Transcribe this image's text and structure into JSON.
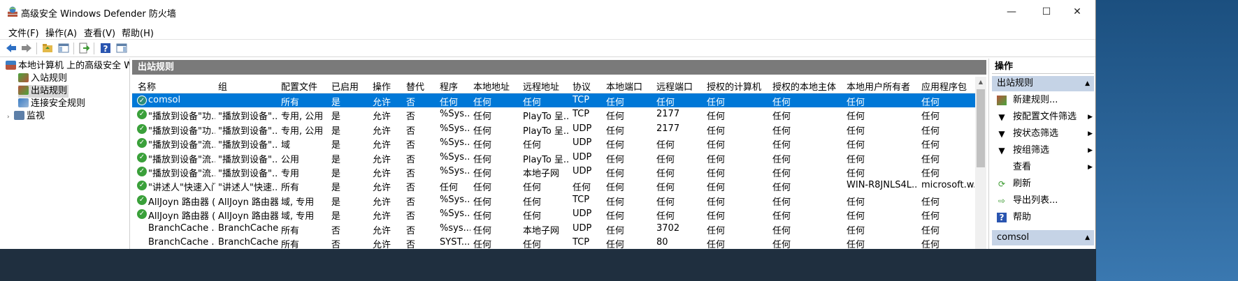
{
  "window": {
    "title": "高级安全 Windows Defender 防火墙",
    "minimize": "—",
    "maximize": "☐",
    "close": "✕"
  },
  "menu": [
    "文件(F)",
    "操作(A)",
    "查看(V)",
    "帮助(H)"
  ],
  "tree": {
    "root": "本地计算机 上的高级安全 Windows Defender 防火墙",
    "items": [
      "入站规则",
      "出站规则",
      "连接安全规则",
      "监视"
    ],
    "selected": "出站规则"
  },
  "panel": {
    "title": "出站规则",
    "columns": [
      "名称",
      "组",
      "配置文件",
      "已启用",
      "操作",
      "替代",
      "程序",
      "本地地址",
      "远程地址",
      "协议",
      "本地端口",
      "远程端口",
      "授权的计算机",
      "授权的本地主体",
      "本地用户所有者",
      "应用程序包"
    ],
    "rows": [
      {
        "icon": true,
        "cells": [
          "comsol",
          "",
          "所有",
          "是",
          "允许",
          "否",
          "任何",
          "任何",
          "任何",
          "TCP",
          "任何",
          "任何",
          "任何",
          "任何",
          "任何",
          "任何"
        ]
      },
      {
        "icon": true,
        "cells": [
          "\"播放到设备\"功...",
          "\"播放到设备\"...",
          "专用, 公用",
          "是",
          "允许",
          "否",
          "%Sys...",
          "任何",
          "PlayTo 呈...",
          "TCP",
          "任何",
          "2177",
          "任何",
          "任何",
          "任何",
          "任何"
        ]
      },
      {
        "icon": true,
        "cells": [
          "\"播放到设备\"功...",
          "\"播放到设备\"...",
          "专用, 公用",
          "是",
          "允许",
          "否",
          "%Sys...",
          "任何",
          "PlayTo 呈...",
          "UDP",
          "任何",
          "2177",
          "任何",
          "任何",
          "任何",
          "任何"
        ]
      },
      {
        "icon": true,
        "cells": [
          "\"播放到设备\"流...",
          "\"播放到设备\"...",
          "域",
          "是",
          "允许",
          "否",
          "%Sys...",
          "任何",
          "任何",
          "UDP",
          "任何",
          "任何",
          "任何",
          "任何",
          "任何",
          "任何"
        ]
      },
      {
        "icon": true,
        "cells": [
          "\"播放到设备\"流...",
          "\"播放到设备\"...",
          "公用",
          "是",
          "允许",
          "否",
          "%Sys...",
          "任何",
          "PlayTo 呈...",
          "UDP",
          "任何",
          "任何",
          "任何",
          "任何",
          "任何",
          "任何"
        ]
      },
      {
        "icon": true,
        "cells": [
          "\"播放到设备\"流...",
          "\"播放到设备\"...",
          "专用",
          "是",
          "允许",
          "否",
          "%Sys...",
          "任何",
          "本地子网",
          "UDP",
          "任何",
          "任何",
          "任何",
          "任何",
          "任何",
          "任何"
        ]
      },
      {
        "icon": true,
        "cells": [
          "\"讲述人\"快速入门",
          "\"讲述人\"快速...",
          "所有",
          "是",
          "允许",
          "否",
          "任何",
          "任何",
          "任何",
          "任何",
          "任何",
          "任何",
          "任何",
          "任何",
          "WIN-R8JNLS4L...",
          "microsoft.w..."
        ]
      },
      {
        "icon": true,
        "cells": [
          "AllJoyn 路由器 (...",
          "AllJoyn 路由器",
          "域, 专用",
          "是",
          "允许",
          "否",
          "%Sys...",
          "任何",
          "任何",
          "TCP",
          "任何",
          "任何",
          "任何",
          "任何",
          "任何",
          "任何"
        ]
      },
      {
        "icon": true,
        "cells": [
          "AllJoyn 路由器 (...",
          "AllJoyn 路由器",
          "域, 专用",
          "是",
          "允许",
          "否",
          "%Sys...",
          "任何",
          "任何",
          "UDP",
          "任何",
          "任何",
          "任何",
          "任何",
          "任何",
          "任何"
        ]
      },
      {
        "icon": false,
        "cells": [
          "BranchCache ...",
          "BranchCache...",
          "所有",
          "否",
          "允许",
          "否",
          "%sys...",
          "任何",
          "本地子网",
          "UDP",
          "任何",
          "3702",
          "任何",
          "任何",
          "任何",
          "任何"
        ]
      },
      {
        "icon": false,
        "cells": [
          "BranchCache ...",
          "BranchCache...",
          "所有",
          "否",
          "允许",
          "否",
          "SYST...",
          "任何",
          "任何",
          "TCP",
          "任何",
          "80",
          "任何",
          "任何",
          "任何",
          "任何"
        ]
      }
    ]
  },
  "actions": {
    "title": "操作",
    "section1": "出站规则",
    "items": [
      "新建规则...",
      "按配置文件筛选",
      "按状态筛选",
      "按组筛选",
      "查看",
      "刷新",
      "导出列表...",
      "帮助"
    ],
    "section2": "comsol"
  }
}
